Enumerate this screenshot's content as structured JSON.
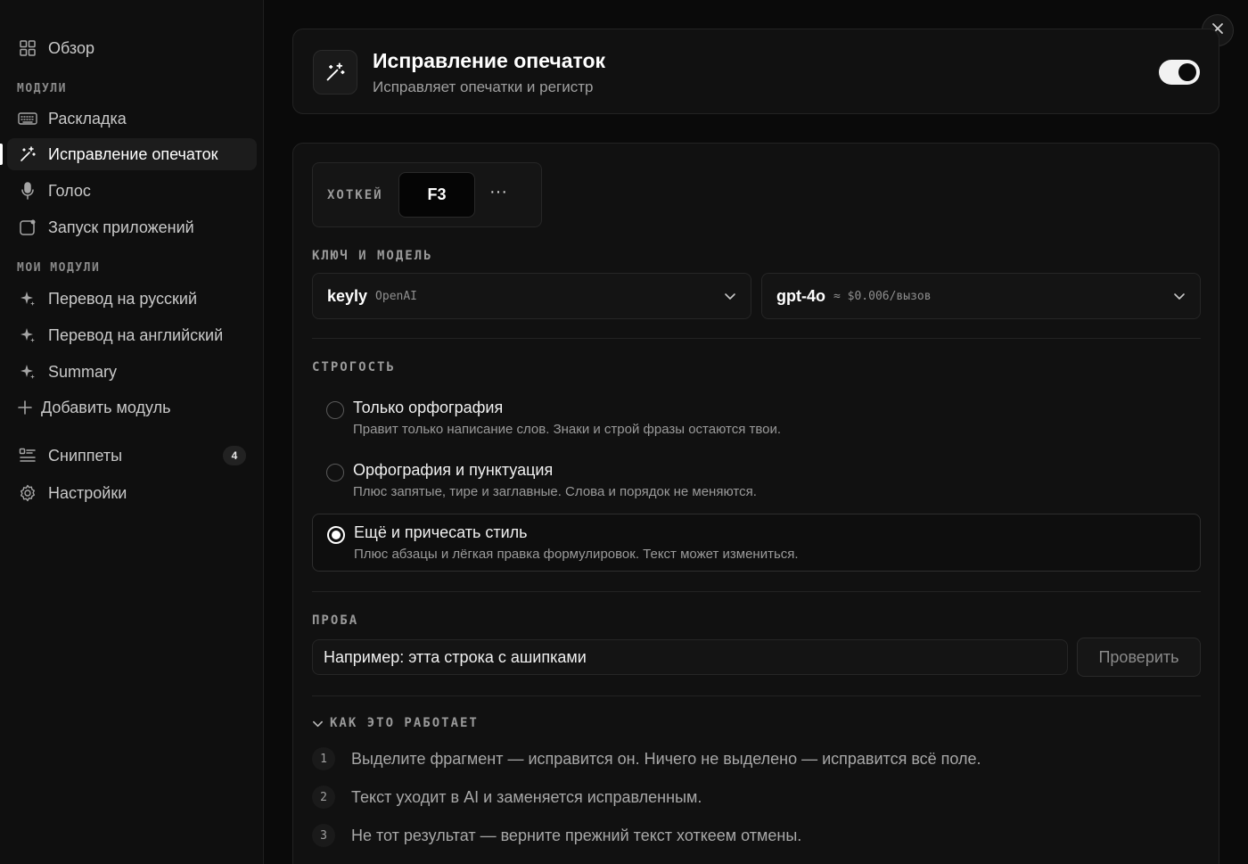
{
  "sidebar": {
    "overview": "Обзор",
    "section_modules": "МОДУЛИ",
    "modules": [
      "Раскладка",
      "Исправление опечаток",
      "Голос",
      "Запуск приложений"
    ],
    "section_my_modules": "МОИ МОДУЛИ",
    "my_modules": [
      "Перевод на русский",
      "Перевод на английский",
      "Summary"
    ],
    "add_module": "Добавить модуль",
    "snippets": "Сниппеты",
    "snippets_count": "4",
    "settings": "Настройки"
  },
  "header": {
    "title": "Исправление опечаток",
    "subtitle": "Исправляет опечатки и регистр",
    "enabled": true
  },
  "hotkey": {
    "label": "ХОТКЕЙ",
    "key": "F3",
    "more": "···"
  },
  "key_model": {
    "label": "КЛЮЧ И МОДЕЛЬ",
    "key_name": "keyly",
    "key_provider": "OpenAI",
    "model_name": "gpt-4o",
    "model_price": "≈ $0.006/вызов"
  },
  "strictness": {
    "label": "СТРОГОСТЬ",
    "options": [
      {
        "title": "Только орфография",
        "desc": "Правит только написание слов. Знаки и строй фразы остаются твои.",
        "selected": false
      },
      {
        "title": "Орфография и пунктуация",
        "desc": "Плюс запятые, тире и заглавные. Слова и порядок не меняются.",
        "selected": false
      },
      {
        "title": "Ещё и причесать стиль",
        "desc": "Плюс абзацы и лёгкая правка формулировок. Текст может измениться.",
        "selected": true
      }
    ]
  },
  "test": {
    "label": "ПРОБА",
    "value": "Например: этта строка с ашипками",
    "button": "Проверить"
  },
  "how": {
    "label": "КАК ЭТО РАБОТАЕТ",
    "steps": [
      {
        "num": "1",
        "text": "Выделите фрагмент — исправится он. Ничего не выделено — исправится всё поле."
      },
      {
        "num": "2",
        "text": "Текст уходит в AI и заменяется исправленным."
      },
      {
        "num": "3",
        "text": "Не тот результат — верните прежний текст хоткеем отмены."
      }
    ]
  }
}
